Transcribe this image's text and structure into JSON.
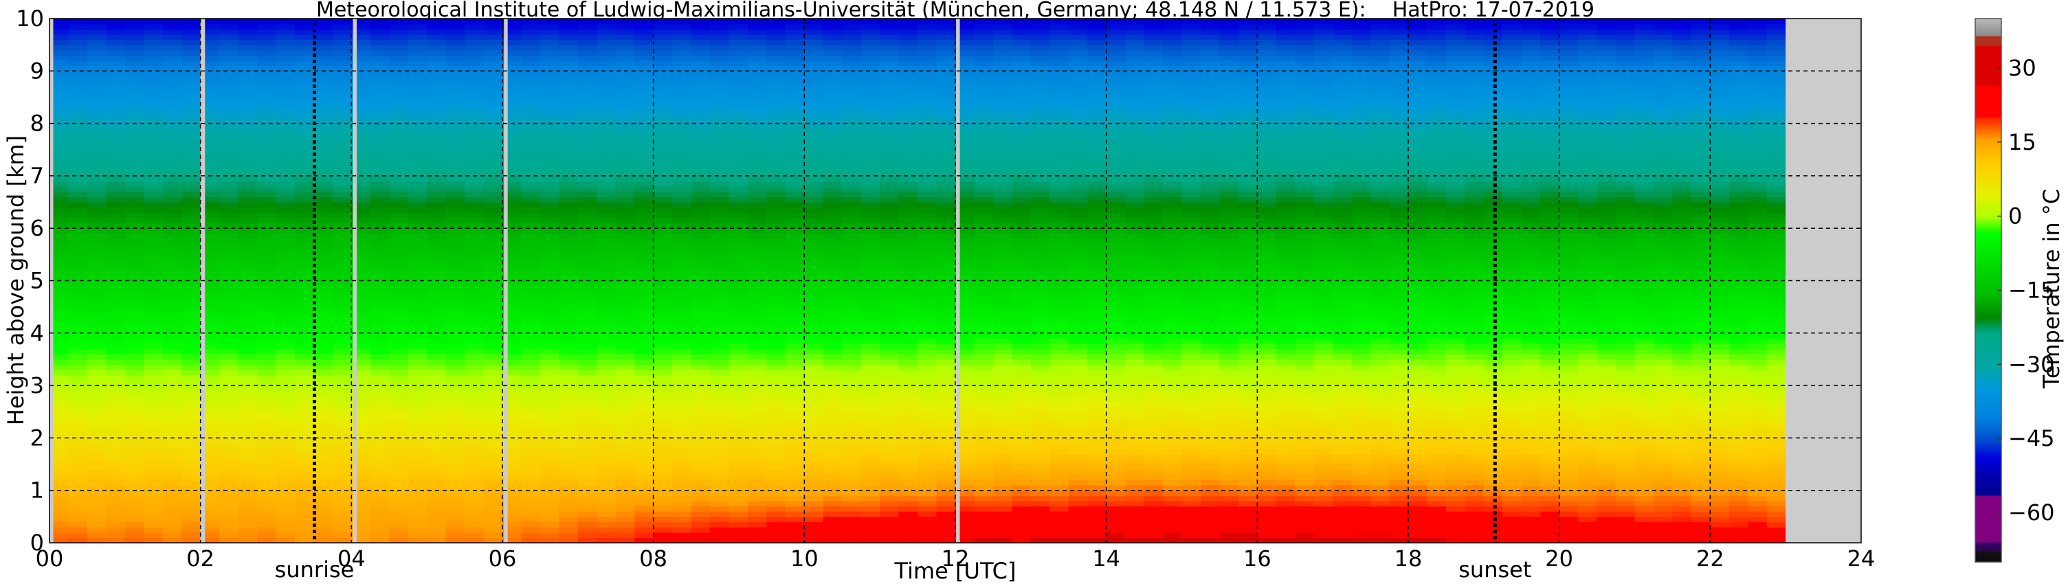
{
  "chart_data": {
    "type": "heatmap",
    "title": "Meteorological Institute of Ludwig-Maximilians-Universität (München, Germany; 48.148 N / 11.573 E):    HatPro: 17-07-2019",
    "xlabel": "Time [UTC]",
    "ylabel": "Height above ground [km]",
    "colorbar_label": "Temperature in °C",
    "xlim": [
      0,
      24
    ],
    "ylim": [
      0,
      10
    ],
    "clim": [
      -70,
      40
    ],
    "grid": true,
    "xticks": [
      "00",
      "02",
      "04",
      "06",
      "08",
      "10",
      "12",
      "14",
      "16",
      "18",
      "20",
      "22",
      "24"
    ],
    "yticks": [
      "0",
      "1",
      "2",
      "3",
      "4",
      "5",
      "6",
      "7",
      "8",
      "9",
      "10"
    ],
    "colorbar_ticks": [
      "30",
      "15",
      "0",
      "−15",
      "−30",
      "−45",
      "−60"
    ],
    "colorbar_tick_values": [
      30,
      15,
      0,
      -15,
      -30,
      -45,
      -60
    ],
    "events": [
      {
        "label": "sunrise",
        "time": 3.51
      },
      {
        "label": "sunset",
        "time": 19.15
      }
    ],
    "missing_intervals": [
      [
        0,
        0.05
      ],
      [
        2.0,
        2.06
      ],
      [
        4.02,
        4.07
      ],
      [
        6.02,
        6.07
      ],
      [
        12.01,
        12.06
      ],
      [
        23.0,
        24.0
      ]
    ],
    "missing_color": "#cccccc",
    "times": [
      0,
      2,
      4,
      6,
      8,
      10,
      12,
      14,
      16,
      18,
      20,
      22,
      23
    ],
    "heights": [
      0,
      0.5,
      1,
      1.5,
      2,
      2.5,
      3,
      3.5,
      4,
      4.5,
      5,
      5.5,
      6,
      6.5,
      7,
      7.5,
      8,
      8.5,
      9,
      9.5,
      10
    ],
    "temperature": [
      [
        18,
        17,
        16,
        17,
        21,
        25,
        27,
        28,
        28.5,
        28,
        25,
        23,
        22
      ],
      [
        15,
        15,
        14.5,
        15,
        17,
        19,
        21,
        22,
        22,
        22,
        20,
        19,
        18.5
      ],
      [
        13,
        13,
        12.5,
        13,
        13.5,
        14,
        16,
        17,
        17,
        17,
        16,
        15.5,
        15
      ],
      [
        10,
        10,
        10,
        10,
        10.5,
        11,
        12,
        13,
        13,
        13,
        12.5,
        12,
        12
      ],
      [
        7,
        7,
        7,
        7,
        7.5,
        8,
        8.5,
        9,
        9,
        9,
        9,
        8.5,
        8.5
      ],
      [
        4,
        4,
        4,
        4,
        4.5,
        5,
        5,
        5.5,
        5.5,
        5.5,
        5.5,
        5,
        5
      ],
      [
        1,
        1,
        1,
        1,
        1.5,
        2,
        2,
        2,
        2,
        2,
        2,
        2,
        2
      ],
      [
        -2,
        -2,
        -2,
        -2,
        -2,
        -1.5,
        -1,
        -1,
        -1,
        -1,
        -1,
        -1,
        -1
      ],
      [
        -5,
        -5,
        -5,
        -5,
        -5,
        -4.5,
        -4,
        -4,
        -4,
        -4,
        -4,
        -4,
        -4
      ],
      [
        -8,
        -8,
        -8,
        -8,
        -8,
        -7.5,
        -7.5,
        -7,
        -7,
        -7,
        -7,
        -7,
        -7
      ],
      [
        -11,
        -11,
        -11,
        -11,
        -11,
        -11,
        -10.5,
        -10.5,
        -10.5,
        -10.5,
        -10.5,
        -10.5,
        -10.5
      ],
      [
        -14,
        -14,
        -14,
        -14,
        -14,
        -14,
        -14,
        -14,
        -14,
        -14,
        -14,
        -14,
        -14
      ],
      [
        -17,
        -17,
        -17,
        -17,
        -17.5,
        -17.5,
        -17.5,
        -17.5,
        -17.5,
        -17.5,
        -17.5,
        -17.5,
        -17.5
      ],
      [
        -21,
        -21,
        -21,
        -21,
        -21,
        -21,
        -21,
        -21,
        -21,
        -21,
        -21,
        -21,
        -21
      ],
      [
        -24,
        -24,
        -24,
        -24,
        -24,
        -24,
        -24,
        -24,
        -24,
        -24,
        -24,
        -24,
        -24
      ],
      [
        -28,
        -28,
        -28,
        -28,
        -28,
        -28,
        -28,
        -28,
        -28,
        -28,
        -28,
        -28,
        -28
      ],
      [
        -32,
        -32,
        -32,
        -32,
        -32,
        -32,
        -32,
        -32,
        -32,
        -32,
        -32,
        -32,
        -32
      ],
      [
        -36,
        -36,
        -36,
        -36,
        -36,
        -36,
        -36,
        -36,
        -36,
        -36,
        -36,
        -36,
        -36
      ],
      [
        -40,
        -40,
        -40,
        -40,
        -40,
        -40,
        -40,
        -40,
        -40,
        -40,
        -40,
        -40,
        -40
      ],
      [
        -45,
        -45,
        -45,
        -45,
        -45,
        -45,
        -45,
        -45,
        -45,
        -45,
        -45,
        -45,
        -45
      ],
      [
        -50,
        -50,
        -50,
        -50,
        -50,
        -50,
        -50,
        -50,
        -50,
        -50,
        -50,
        -50,
        -50
      ]
    ],
    "colormap": [
      [
        -70,
        "#0a0a0a"
      ],
      [
        -67.8,
        "#111111"
      ],
      [
        -67.7,
        "#300060"
      ],
      [
        -65.9,
        "#300060"
      ],
      [
        -65.8,
        "#800080"
      ],
      [
        -56.5,
        "#800080"
      ],
      [
        -56.4,
        "#000090"
      ],
      [
        -52.8,
        "#0000aa"
      ],
      [
        -48.9,
        "#0000dd"
      ],
      [
        -45,
        "#0050cc"
      ],
      [
        -41,
        "#0080dd"
      ],
      [
        -34.8,
        "#0099dd"
      ],
      [
        -30.8,
        "#00a8a8"
      ],
      [
        -23.8,
        "#00aa88"
      ],
      [
        -22.2,
        "#009955"
      ],
      [
        -20.6,
        "#008800"
      ],
      [
        -16,
        "#00bb00"
      ],
      [
        -9.6,
        "#00dd00"
      ],
      [
        -3.4,
        "#00ff00"
      ],
      [
        0,
        "#b0ff00"
      ],
      [
        4.5,
        "#e6f000"
      ],
      [
        10.8,
        "#ffcc00"
      ],
      [
        15.5,
        "#ffa000"
      ],
      [
        20,
        "#ff2000"
      ],
      [
        20.1,
        "#ff0000"
      ],
      [
        26.5,
        "#ff0000"
      ],
      [
        26.6,
        "#dd0000"
      ],
      [
        34.5,
        "#dd0000"
      ],
      [
        34.6,
        "#b03020"
      ],
      [
        36.3,
        "#b03020"
      ],
      [
        36.4,
        "#888888"
      ],
      [
        40,
        "#b8b8b8"
      ]
    ]
  }
}
